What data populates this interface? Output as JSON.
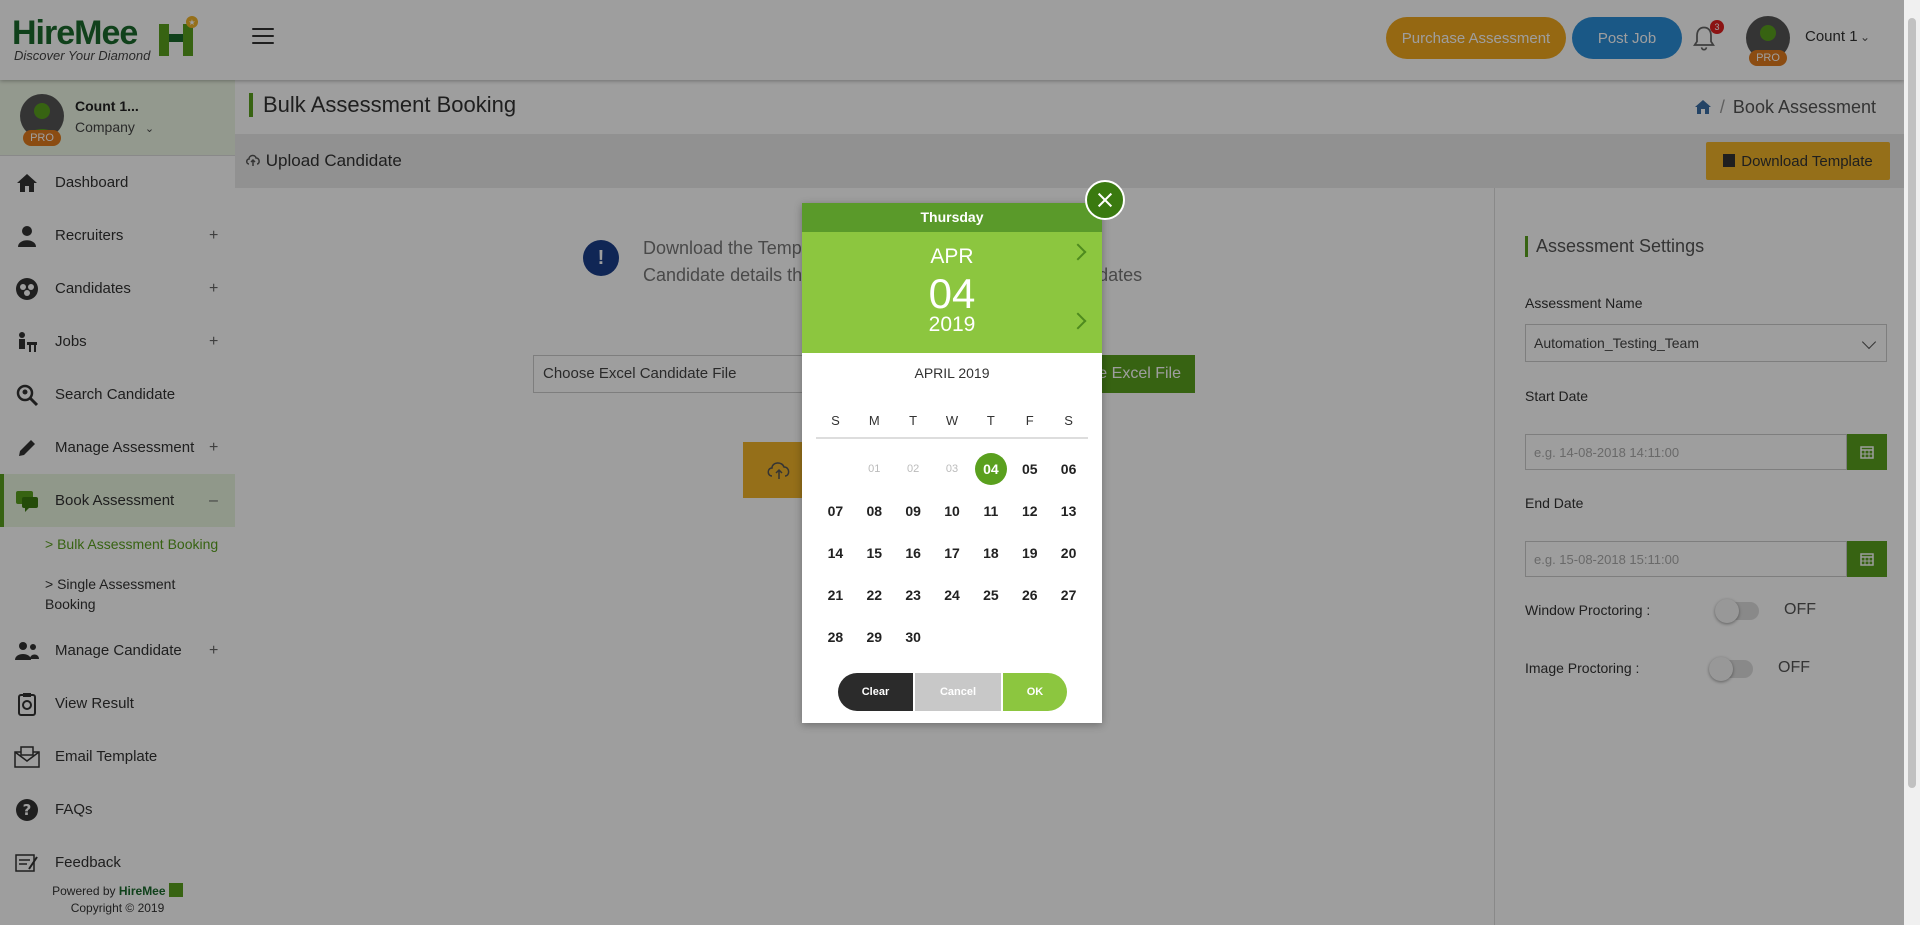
{
  "brand": {
    "name_a": "Hire",
    "name_b": "Mee",
    "tagline": "Discover Your Diamond"
  },
  "topbar": {
    "purchase_label": "Purchase Assessment",
    "post_job_label": "Post Job",
    "notification_count": "3",
    "user_name": "Count 1",
    "pro_badge": "PRO"
  },
  "sidebar": {
    "profile_name": "Count 1...",
    "profile_role": "Company",
    "pro_badge": "PRO",
    "items": [
      {
        "label": "Dashboard",
        "icon": "home-icon",
        "expandable": false
      },
      {
        "label": "Recruiters",
        "icon": "recruiters-icon",
        "expandable": true
      },
      {
        "label": "Candidates",
        "icon": "candidates-icon",
        "expandable": true
      },
      {
        "label": "Jobs",
        "icon": "jobs-icon",
        "expandable": true
      },
      {
        "label": "Search Candidate",
        "icon": "search-candidate-icon",
        "expandable": false
      },
      {
        "label": "Manage Assessment",
        "icon": "pencil-icon",
        "expandable": true
      },
      {
        "label": "Book Assessment",
        "icon": "book-assessment-icon",
        "expandable": true,
        "expanded": true
      },
      {
        "label": "Manage Candidate",
        "icon": "manage-candidate-icon",
        "expandable": true
      },
      {
        "label": "View Result",
        "icon": "view-result-icon",
        "expandable": false
      },
      {
        "label": "Email Template",
        "icon": "email-template-icon",
        "expandable": false
      },
      {
        "label": "FAQs",
        "icon": "faq-icon",
        "expandable": false
      },
      {
        "label": "Feedback",
        "icon": "feedback-icon",
        "expandable": false
      }
    ],
    "subitems": {
      "bulk": "Bulk Assessment Booking",
      "single_line1": "Single Assessment",
      "single_line2": "Booking"
    },
    "expand_symbol": "+",
    "collapse_symbol": "–",
    "footer": {
      "powered_by": "Powered by",
      "copyright": "Copyright © 2019"
    }
  },
  "page": {
    "title": "Bulk Assessment Booking",
    "breadcrumb": "Book Assessment",
    "breadcrumb_sep": "/",
    "section_title": "Upload Candidate",
    "download_template_label": "Download Template",
    "info_line1_left": "Download the Temp",
    "info_line1_right": "",
    "info_line2_left": "Candidate details th",
    "info_line2_right": "dates",
    "file_placeholder": "Choose Excel Candidate File",
    "choose_btn_label": "e Excel File"
  },
  "settings": {
    "title": "Assessment Settings",
    "assessment_name_label": "Assessment Name",
    "assessment_name_value": "Automation_Testing_Team",
    "start_date_label": "Start Date",
    "start_date_placeholder": "e.g. 14-08-2018 14:11:00",
    "end_date_label": "End Date",
    "end_date_placeholder": "e.g. 15-08-2018 15:11:00",
    "window_proctoring_label": "Window Proctoring :",
    "window_proctoring_state": "OFF",
    "image_proctoring_label": "Image Proctoring :",
    "image_proctoring_state": "OFF"
  },
  "datepicker": {
    "weekday": "Thursday",
    "month_short": "APR",
    "day": "04",
    "year": "2019",
    "title": "APRIL 2019",
    "week_headers": [
      "S",
      "M",
      "T",
      "W",
      "T",
      "F",
      "S"
    ],
    "weeks": [
      [
        "",
        "01",
        "02",
        "03",
        "04",
        "05",
        "06"
      ],
      [
        "07",
        "08",
        "09",
        "10",
        "11",
        "12",
        "13"
      ],
      [
        "14",
        "15",
        "16",
        "17",
        "18",
        "19",
        "20"
      ],
      [
        "21",
        "22",
        "23",
        "24",
        "25",
        "26",
        "27"
      ],
      [
        "28",
        "29",
        "30",
        "",
        "",
        "",
        ""
      ]
    ],
    "disabled_days": [
      "01",
      "02",
      "03"
    ],
    "selected_day": "04",
    "clear_label": "Clear",
    "cancel_label": "Cancel",
    "ok_label": "OK"
  },
  "colors": {
    "brand_green": "#5aa01e",
    "light_green": "#8cc63f",
    "accent_orange": "#f0a81e",
    "accent_blue": "#2b8ed9"
  }
}
